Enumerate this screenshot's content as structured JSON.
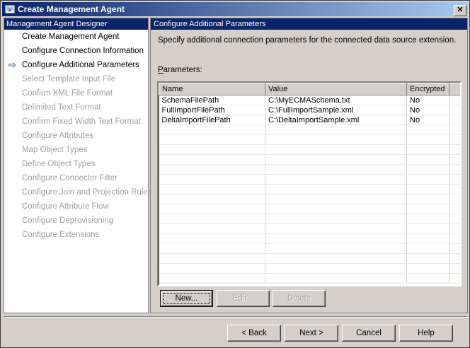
{
  "window": {
    "title": "Create Management Agent",
    "close_glyph": "✕"
  },
  "left_pane": {
    "header": "Management Agent Designer",
    "current_step_icon": "arrow-right-icon",
    "items": [
      {
        "label": "Create Management Agent",
        "enabled": true,
        "current": false
      },
      {
        "label": "Configure Connection Information",
        "enabled": true,
        "current": false
      },
      {
        "label": "Configure Additional Parameters",
        "enabled": true,
        "current": true
      },
      {
        "label": "Select Template Input File",
        "enabled": false,
        "current": false
      },
      {
        "label": "Confirm XML File Format",
        "enabled": false,
        "current": false
      },
      {
        "label": "Delimited Text Format",
        "enabled": false,
        "current": false
      },
      {
        "label": "Confirm Fixed Width Text Format",
        "enabled": false,
        "current": false
      },
      {
        "label": "Configure Attributes",
        "enabled": false,
        "current": false
      },
      {
        "label": "Map Object Types",
        "enabled": false,
        "current": false
      },
      {
        "label": "Define Object Types",
        "enabled": false,
        "current": false
      },
      {
        "label": "Configure Connector Filter",
        "enabled": false,
        "current": false
      },
      {
        "label": "Configure Join and Projection Rules",
        "enabled": false,
        "current": false
      },
      {
        "label": "Configure Attribute Flow",
        "enabled": false,
        "current": false
      },
      {
        "label": "Configure Deprovisioning",
        "enabled": false,
        "current": false
      },
      {
        "label": "Configure Extensions",
        "enabled": false,
        "current": false
      }
    ]
  },
  "right_pane": {
    "header": "Configure Additional Parameters",
    "description": "Specify additional connection parameters for the connected data source extension.",
    "params_label_mnemonic": "P",
    "params_label_rest": "arameters:",
    "columns": [
      "Name",
      "Value",
      "Encrypted"
    ],
    "rows": [
      [
        "SchemaFilePath",
        "C:\\MyECMASchema.txt",
        "No"
      ],
      [
        "FullImportFilePath",
        "C:\\FullImportSample.xml",
        "No"
      ],
      [
        "DeltaImportFilePath",
        "C:\\DeltaImportSample.xml",
        "No"
      ]
    ],
    "buttons": {
      "new": "New...",
      "edit": "Edit...",
      "delete": "Delete"
    }
  },
  "footer": {
    "back": "< Back",
    "next": "Next >",
    "cancel": "Cancel",
    "help": "Help"
  }
}
